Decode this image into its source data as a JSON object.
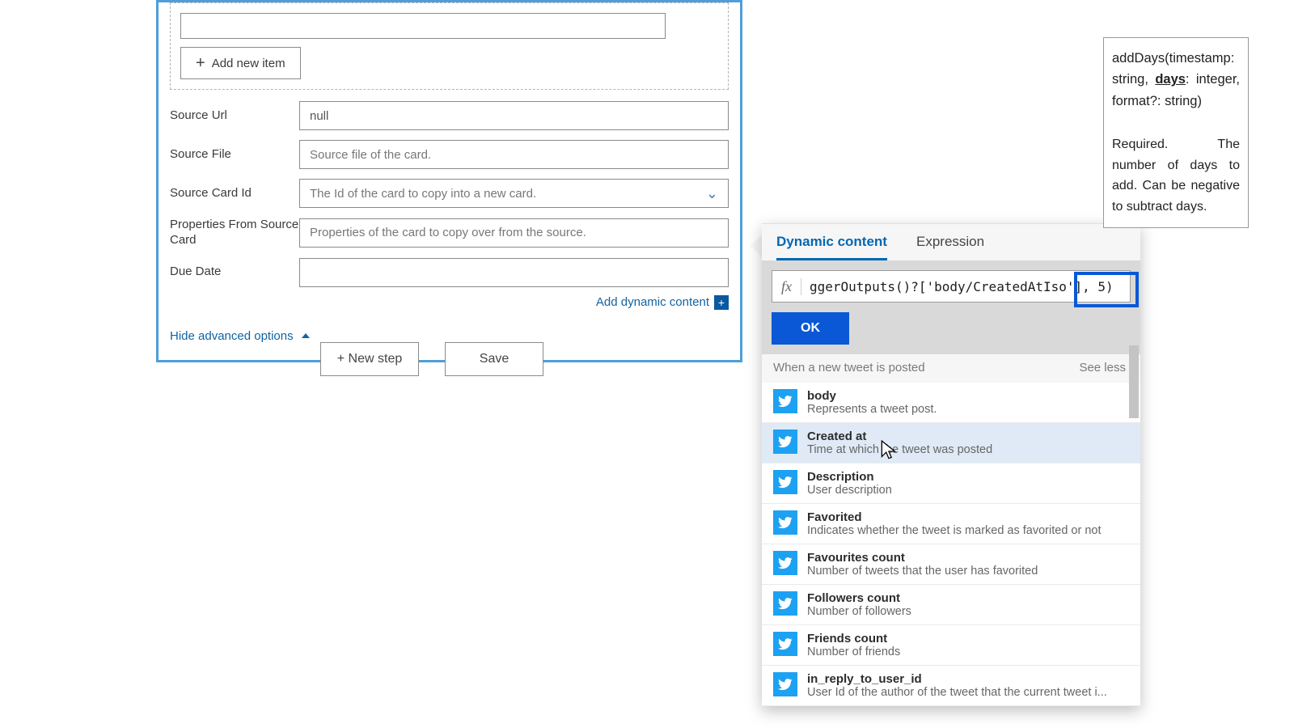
{
  "card": {
    "addItemLabel": "Add new item",
    "fields": {
      "sourceUrl": {
        "label": "Source Url",
        "value": "null"
      },
      "sourceFile": {
        "label": "Source File",
        "placeholder": "Source file of the card."
      },
      "sourceCardId": {
        "label": "Source Card Id",
        "placeholder": "The Id of the card to copy into a new card."
      },
      "propsFromSource": {
        "label": "Properties From Source Card",
        "placeholder": "Properties of the card to copy over from the source."
      },
      "dueDate": {
        "label": "Due Date",
        "value": ""
      }
    },
    "addDynamic": "Add dynamic content",
    "hideAdvanced": "Hide advanced options"
  },
  "buttons": {
    "newStep": "+ New step",
    "save": "Save"
  },
  "dc": {
    "tabDynamic": "Dynamic content",
    "tabExpression": "Expression",
    "fxText": "ggerOutputs()?['body/CreatedAtIso'], 5)",
    "ok": "OK",
    "sectionTitle": "When a new tweet is posted",
    "seeLess": "See less",
    "items": [
      {
        "title": "body",
        "desc": "Represents a tweet post."
      },
      {
        "title": "Created at",
        "desc": "Time at which the tweet was posted"
      },
      {
        "title": "Description",
        "desc": "User description"
      },
      {
        "title": "Favorited",
        "desc": "Indicates whether the tweet is marked as favorited or not"
      },
      {
        "title": "Favourites count",
        "desc": "Number of tweets that the user has favorited"
      },
      {
        "title": "Followers count",
        "desc": "Number of followers"
      },
      {
        "title": "Friends count",
        "desc": "Number of friends"
      },
      {
        "title": "in_reply_to_user_id",
        "desc": "User Id of the author of the tweet that the current tweet i..."
      }
    ]
  },
  "tooltip": {
    "sig1": "addDays(timestamp: string, ",
    "sigDays": "days",
    "sig2": ": integer, format?: string)",
    "desc": "Required. The number of days to add. Can be negative to subtract days."
  }
}
